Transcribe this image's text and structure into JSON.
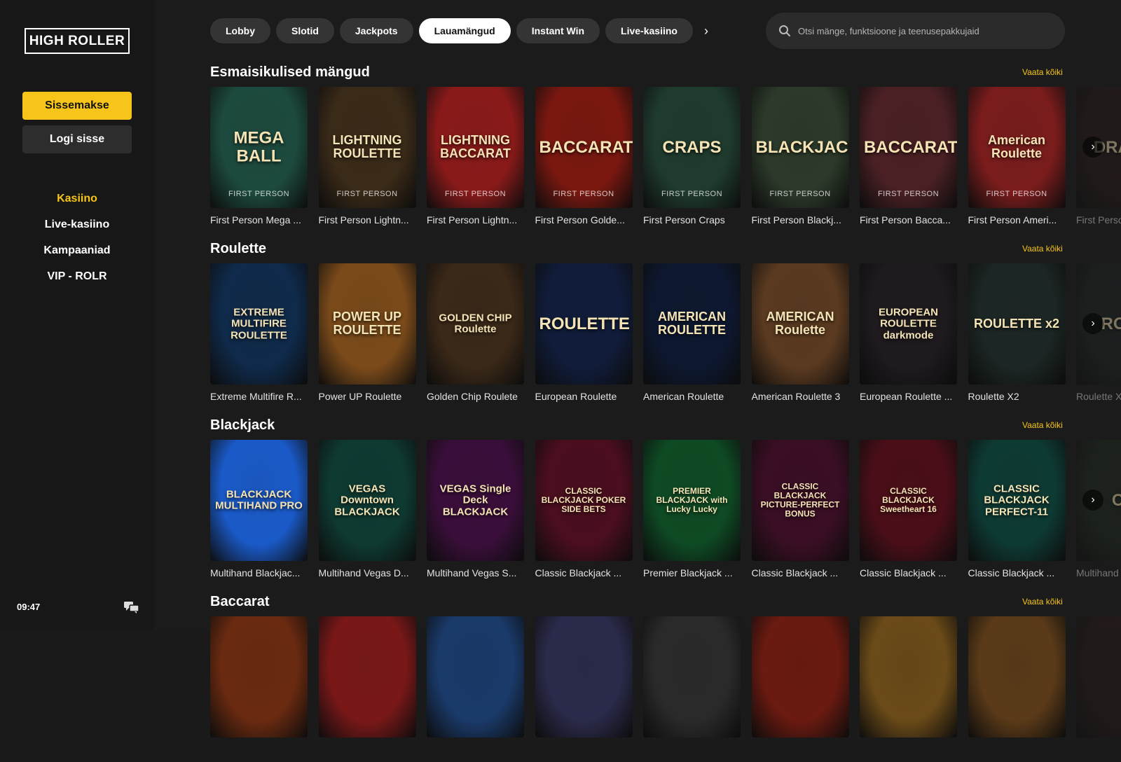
{
  "brand": {
    "logo_text": "HIGH ROLLER",
    "accent": "#f7c519"
  },
  "sidebar": {
    "deposit_label": "Sissemakse",
    "login_label": "Logi sisse",
    "nav": [
      {
        "label": "Kasiino",
        "active": true
      },
      {
        "label": "Live-kasiino"
      },
      {
        "label": "Kampaaniad"
      },
      {
        "label": "VIP - ROLR"
      }
    ],
    "clock": "09:47",
    "chat_icon": "chat-bubbles-icon"
  },
  "header": {
    "tabs": [
      {
        "label": "Lobby"
      },
      {
        "label": "Slotid"
      },
      {
        "label": "Jackpots"
      },
      {
        "label": "Lauamängud",
        "active": true
      },
      {
        "label": "Instant Win"
      },
      {
        "label": "Live-kasiino"
      }
    ],
    "search_placeholder": "Otsi mänge, funktsioone ja teenusepakkujaid"
  },
  "sections": [
    {
      "title": "Esmaisikulised mängud",
      "see_all": "Vaata kõiki",
      "games": [
        {
          "caption": "First Person Mega ...",
          "art": "MEGA BALL",
          "sub": "FIRST PERSON",
          "bg": "#1d4a3e"
        },
        {
          "caption": "First Person Lightn...",
          "art": "LIGHTNING ROULETTE",
          "sub": "FIRST PERSON",
          "bg": "#3a2a18"
        },
        {
          "caption": "First Person Lightn...",
          "art": "LIGHTNING BACCARAT",
          "sub": "FIRST PERSON",
          "bg": "#8a1a1a"
        },
        {
          "caption": "First Person Golde...",
          "art": "BACCARAT",
          "sub": "FIRST PERSON",
          "bg": "#7a1810"
        },
        {
          "caption": "First Person Craps",
          "art": "CRAPS",
          "sub": "FIRST PERSON",
          "bg": "#1f3b2e"
        },
        {
          "caption": "First Person Blackj...",
          "art": "BLACKJACK",
          "sub": "FIRST PERSON",
          "bg": "#2c3a2a"
        },
        {
          "caption": "First Person Bacca...",
          "art": "BACCARAT",
          "sub": "FIRST PERSON",
          "bg": "#4a2024"
        },
        {
          "caption": "First Person Ameri...",
          "art": "American Roulette",
          "sub": "FIRST PERSON",
          "bg": "#7a1c1c"
        },
        {
          "caption": "First Perso",
          "art": "DRAGO",
          "sub": "",
          "bg": "#2a1a1a"
        }
      ]
    },
    {
      "title": "Roulette",
      "see_all": "Vaata kõiki",
      "games": [
        {
          "caption": "Extreme Multifire R...",
          "art": "EXTREME MULTIFIRE ROULETTE",
          "sub": "",
          "bg": "#0f2a4a"
        },
        {
          "caption": "Power UP Roulette",
          "art": "POWER UP ROULETTE",
          "sub": "",
          "bg": "#7a4a1a"
        },
        {
          "caption": "Golden Chip Roulete",
          "art": "GOLDEN CHIP Roulette",
          "sub": "",
          "bg": "#3a2818"
        },
        {
          "caption": "European Roulette",
          "art": "ROULETTE",
          "sub": "",
          "bg": "#101c3a"
        },
        {
          "caption": "American Roulette",
          "art": "AMERICAN ROULETTE",
          "sub": "",
          "bg": "#0d1830"
        },
        {
          "caption": "American Roulette 3",
          "art": "AMERICAN Roulette",
          "sub": "",
          "bg": "#5a3a20"
        },
        {
          "caption": "European Roulette ...",
          "art": "EUROPEAN ROULETTE darkmode",
          "sub": "",
          "bg": "#1e1a1e"
        },
        {
          "caption": "Roulette X2",
          "art": "ROULETTE x2",
          "sub": "",
          "bg": "#1c2624"
        },
        {
          "caption": "Roulette X",
          "art": "ROUL",
          "sub": "",
          "bg": "#1c2624"
        }
      ]
    },
    {
      "title": "Blackjack",
      "see_all": "Vaata kõiki",
      "games": [
        {
          "caption": "Multihand Blackjac...",
          "art": "BLACKJACK MULTIHAND PRO",
          "sub": "",
          "bg": "#1a5ac8"
        },
        {
          "caption": "Multihand Vegas D...",
          "art": "VEGAS Downtown BLACKJACK",
          "sub": "",
          "bg": "#0e3a32"
        },
        {
          "caption": "Multihand Vegas S...",
          "art": "VEGAS Single Deck BLACKJACK",
          "sub": "",
          "bg": "#3a0e3a"
        },
        {
          "caption": "Classic Blackjack ...",
          "art": "CLASSIC BLACKJACK POKER SIDE BETS",
          "sub": "",
          "bg": "#4a0e1e"
        },
        {
          "caption": "Premier Blackjack ...",
          "art": "PREMIER BLACKJACK with Lucky Lucky",
          "sub": "",
          "bg": "#0e4a24"
        },
        {
          "caption": "Classic Blackjack ...",
          "art": "CLASSIC BLACKJACK PICTURE-PERFECT BONUS",
          "sub": "",
          "bg": "#3a0e24"
        },
        {
          "caption": "Classic Blackjack ...",
          "art": "CLASSIC BLACKJACK Sweetheart 16",
          "sub": "",
          "bg": "#4a0e18"
        },
        {
          "caption": "Classic Blackjack ...",
          "art": "CLASSIC BLACKJACK PERFECT-11",
          "sub": "",
          "bg": "#0e3a34"
        },
        {
          "caption": "Multihand",
          "art": "Cla",
          "sub": "",
          "bg": "#1e2a1e"
        }
      ]
    },
    {
      "title": "Baccarat",
      "see_all": "Vaata kõiki",
      "games": [
        {
          "caption": "",
          "art": "",
          "sub": "",
          "bg": "#6a2a10"
        },
        {
          "caption": "",
          "art": "",
          "sub": "",
          "bg": "#7a1818"
        },
        {
          "caption": "",
          "art": "",
          "sub": "",
          "bg": "#1a3a6a"
        },
        {
          "caption": "",
          "art": "",
          "sub": "",
          "bg": "#2a2a4a"
        },
        {
          "caption": "",
          "art": "",
          "sub": "",
          "bg": "#2a2a2a"
        },
        {
          "caption": "",
          "art": "",
          "sub": "",
          "bg": "#6a1a10"
        },
        {
          "caption": "",
          "art": "",
          "sub": "",
          "bg": "#6a4a18"
        },
        {
          "caption": "",
          "art": "",
          "sub": "",
          "bg": "#5a3a18"
        },
        {
          "caption": "",
          "art": "",
          "sub": "",
          "bg": "#2a1a1a"
        }
      ]
    }
  ]
}
